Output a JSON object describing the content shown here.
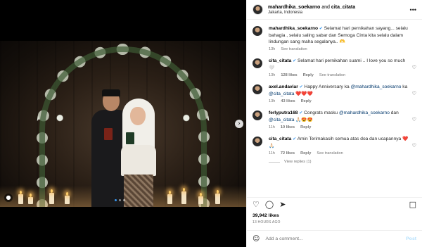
{
  "post": {
    "author": "mahardhika_soekarno",
    "conjunction": "and",
    "collaborator": "cita_citata",
    "location": "Jakarta, Indonesia",
    "more_icon": "more-horizontal-icon"
  },
  "comments": [
    {
      "user": "mahardhika_soekarno",
      "verified": true,
      "text": "Selamat hari pernikahan sayang... selalu bahagia , selalu saling sabar dan Semoga Cinta kita selalu dalam lindungan sang maha segalanya.. 🫶",
      "time": "13h",
      "likes": "",
      "reply": "",
      "translation": "See translation"
    },
    {
      "user": "cita_citata",
      "verified": true,
      "text": "Selamat hari pernikahan suami .. I love you so much 🤍",
      "time": "13h",
      "likes": "128 likes",
      "reply": "Reply",
      "translation": "See translation"
    },
    {
      "user": "axel.andaviar",
      "verified": true,
      "mention_prefix": "Happy Anniversary ka ",
      "mention1": "@mahardhika_soekarno",
      "mention_mid": " ka ",
      "mention2": "@cita_citata",
      "mention_suffix": " ❤️❤️❤️",
      "time": "13h",
      "likes": "43 likes",
      "reply": "Reply"
    },
    {
      "user": "ferlyputra168",
      "verified": true,
      "mention_prefix": "Congrats masku ",
      "mention1": "@mahardhika_soekarno",
      "mention_mid": " dan ",
      "mention2": "@cita_citata",
      "mention_suffix": " 🙏🏻😍😍",
      "time": "11h",
      "likes": "10 likes",
      "reply": "Reply"
    },
    {
      "user": "cita_citata",
      "verified": true,
      "text": "Amin Terimakasih semua atas doa dan ucapannya ❤️🙏🏻",
      "time": "11h",
      "likes": "72 likes",
      "reply": "Reply",
      "translation": "See translation"
    }
  ],
  "view_replies": "View replies (1)",
  "actions": {
    "like_icon": "heart-icon",
    "comment_icon": "comment-icon",
    "share_icon": "share-icon",
    "save_icon": "bookmark-icon"
  },
  "likes_count": "39,942 likes",
  "posted_time": "13 HOURS AGO",
  "add_comment": {
    "placeholder": "Add a comment...",
    "post_label": "Post",
    "emoji_icon": "emoji-icon"
  },
  "media": {
    "carousel_dots": 3,
    "active_dot": 0,
    "next_icon": "chevron-right-icon",
    "tag_icon": "user-tag-icon"
  }
}
